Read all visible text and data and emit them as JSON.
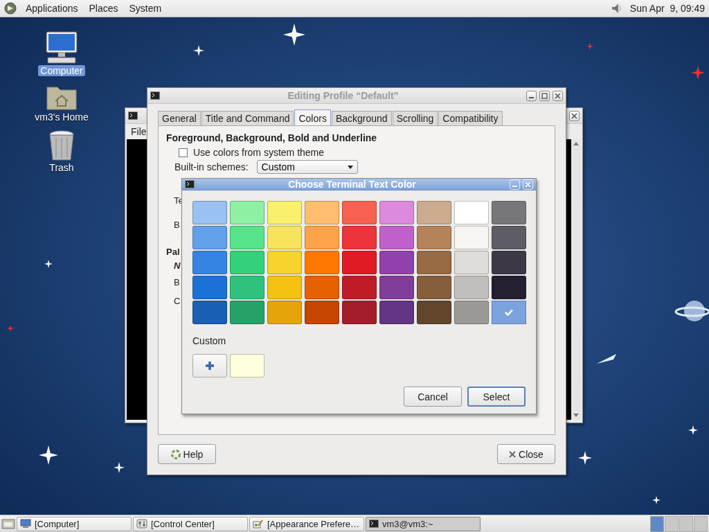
{
  "top_panel": {
    "menus": [
      "Applications",
      "Places",
      "System"
    ],
    "clock": "Sun Apr  9, 09:49"
  },
  "desktop_icons": [
    {
      "kind": "computer",
      "label": "Computer",
      "selected": true
    },
    {
      "kind": "home",
      "label": "vm3's Home",
      "selected": false
    },
    {
      "kind": "trash",
      "label": "Trash",
      "selected": false
    }
  ],
  "terminal_window": {
    "menu_item": "File"
  },
  "profile_dialog": {
    "title": "Editing Profile “Default”",
    "tabs": [
      {
        "label": "General",
        "selected": false
      },
      {
        "label": "Title and Command",
        "selected": false
      },
      {
        "label": "Colors",
        "selected": true
      },
      {
        "label": "Background",
        "selected": false
      },
      {
        "label": "Scrolling",
        "selected": false
      },
      {
        "label": "Compatibility",
        "selected": false
      }
    ],
    "heading": "Foreground, Background, Bold and Underline",
    "system_colors_checkbox": {
      "label": "Use colors from system theme",
      "checked": false
    },
    "scheme": {
      "label": "Built-in schemes:",
      "value": "Custom"
    },
    "cut_labels": [
      {
        "kind": "label",
        "text": "Te"
      },
      {
        "kind": "label",
        "text": "B"
      },
      {
        "kind": "heading",
        "text": "Pal"
      },
      {
        "kind": "note",
        "text": "N"
      },
      {
        "kind": "label",
        "text": "B"
      },
      {
        "kind": "label",
        "text": "C"
      }
    ],
    "help_button": "Help",
    "close_button": "Close"
  },
  "color_dialog": {
    "title": "Choose Terminal Text Color",
    "swatches": [
      {
        "color": "#99c1f1",
        "selected": false
      },
      {
        "color": "#8ff0a4",
        "selected": false
      },
      {
        "color": "#f9f06b",
        "selected": false
      },
      {
        "color": "#ffbe6f",
        "selected": false
      },
      {
        "color": "#f66151",
        "selected": false
      },
      {
        "color": "#dc8add",
        "selected": false
      },
      {
        "color": "#cdab8f",
        "selected": false
      },
      {
        "color": "#ffffff",
        "selected": false
      },
      {
        "color": "#77767b",
        "selected": false
      },
      {
        "color": "#62a0ea",
        "selected": false
      },
      {
        "color": "#57e389",
        "selected": false
      },
      {
        "color": "#f8e45c",
        "selected": false
      },
      {
        "color": "#ffa348",
        "selected": false
      },
      {
        "color": "#ed333b",
        "selected": false
      },
      {
        "color": "#c061cb",
        "selected": false
      },
      {
        "color": "#b5835a",
        "selected": false
      },
      {
        "color": "#f6f5f4",
        "selected": false
      },
      {
        "color": "#5e5c64",
        "selected": false
      },
      {
        "color": "#3584e4",
        "selected": false
      },
      {
        "color": "#33d17a",
        "selected": false
      },
      {
        "color": "#f6d32d",
        "selected": false
      },
      {
        "color": "#ff7800",
        "selected": false
      },
      {
        "color": "#e01b24",
        "selected": false
      },
      {
        "color": "#9141ac",
        "selected": false
      },
      {
        "color": "#986a44",
        "selected": false
      },
      {
        "color": "#deddda",
        "selected": false
      },
      {
        "color": "#3d3846",
        "selected": false
      },
      {
        "color": "#1c71d8",
        "selected": false
      },
      {
        "color": "#2ec27e",
        "selected": false
      },
      {
        "color": "#f5c211",
        "selected": false
      },
      {
        "color": "#e66100",
        "selected": false
      },
      {
        "color": "#c01c28",
        "selected": false
      },
      {
        "color": "#813d9c",
        "selected": false
      },
      {
        "color": "#865e3c",
        "selected": false
      },
      {
        "color": "#c0bfbc",
        "selected": false
      },
      {
        "color": "#241f31",
        "selected": false
      },
      {
        "color": "#1a5fb4",
        "selected": false
      },
      {
        "color": "#26a269",
        "selected": false
      },
      {
        "color": "#e5a50a",
        "selected": false
      },
      {
        "color": "#c64600",
        "selected": false
      },
      {
        "color": "#a51d2d",
        "selected": false
      },
      {
        "color": "#613583",
        "selected": false
      },
      {
        "color": "#63452c",
        "selected": false
      },
      {
        "color": "#9a9996",
        "selected": false
      },
      {
        "color": "#7ba3dc",
        "selected": true
      }
    ],
    "custom_label": "Custom",
    "custom_colors": [
      {
        "color": "#ffffdd",
        "selected": false
      }
    ],
    "buttons": [
      {
        "label": "Cancel",
        "default": false
      },
      {
        "label": "Select",
        "default": true
      }
    ]
  },
  "taskbar": {
    "tasks": [
      {
        "kind": "computer",
        "label": "[Computer]",
        "selected": false
      },
      {
        "kind": "control",
        "label": "[Control Center]",
        "selected": false
      },
      {
        "kind": "appearance",
        "label": "[Appearance Prefere…",
        "selected": false
      },
      {
        "kind": "terminal",
        "label": "vm3@vm3:~",
        "selected": true
      }
    ],
    "workspaces": [
      {
        "selected": true
      },
      {
        "selected": false
      },
      {
        "selected": false
      },
      {
        "selected": false
      }
    ]
  }
}
